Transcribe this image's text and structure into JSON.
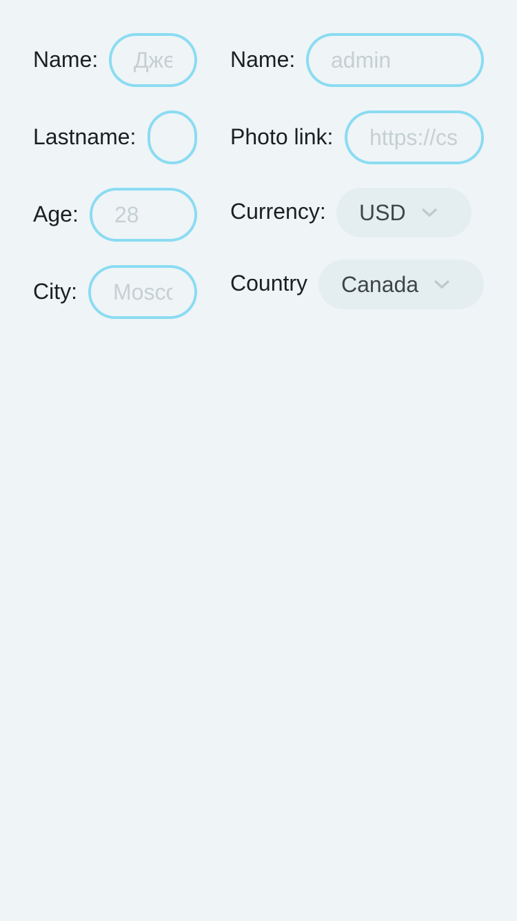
{
  "left": {
    "name": {
      "label": "Name:",
      "placeholder": "Джек"
    },
    "lastname": {
      "label": "Lastname:",
      "placeholder": ""
    },
    "age": {
      "label": "Age:",
      "placeholder": "28"
    },
    "city": {
      "label": "City:",
      "placeholder": "Moscow"
    }
  },
  "right": {
    "name": {
      "label": "Name:",
      "placeholder": "admin"
    },
    "photo": {
      "label": "Photo link:",
      "placeholder": "https://cs"
    },
    "currency": {
      "label": "Currency:",
      "value": "USD",
      "icon": "chevron-down-icon"
    },
    "country": {
      "label": "Country",
      "value": "Canada",
      "icon": "chevron-down-icon"
    }
  },
  "colors": {
    "accent_border": "#8adcf2",
    "background": "#eff4f7",
    "select_bg": "#e4eef0",
    "placeholder": "#c5d0d1"
  }
}
